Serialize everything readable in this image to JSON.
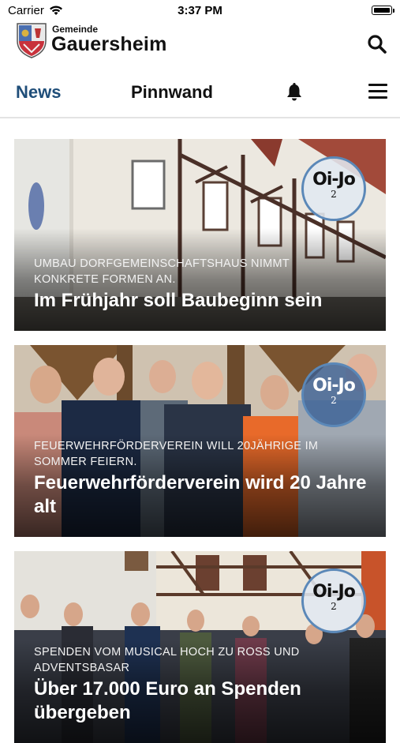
{
  "status_bar": {
    "carrier": "Carrier",
    "time": "3:37 PM"
  },
  "header": {
    "brand_small": "Gemeinde",
    "brand_name": "Gauersheim"
  },
  "nav": {
    "tabs": [
      {
        "label": "News",
        "active": true
      },
      {
        "label": "Pinnwand",
        "active": false
      }
    ],
    "accent_color": "#1f4e79"
  },
  "articles": [
    {
      "kicker": "UMBAU DORFGEMEINSCHAFTSHAUS NIMMT KONKRETE FORMEN AN.",
      "title": "Im Frühjahr soll Baubeginn sein",
      "badge": {
        "title": "Oi-Jo",
        "number": "2"
      }
    },
    {
      "kicker": "FEUERWEHRFÖRDERVEREIN WILL 20JÄHRIGE IM SOMMER FEIERN.",
      "title": "Feuerwehrförderverein wird 20 Jahre alt",
      "badge": {
        "title": "Oi-Jo",
        "number": "2"
      }
    },
    {
      "kicker": "SPENDEN VOM MUSICAL HOCH ZU ROSS UND ADVENTSBASAR",
      "title": "Über 17.000 Euro an Spenden übergeben",
      "badge": {
        "title": "Oi-Jo",
        "number": "2"
      }
    }
  ]
}
